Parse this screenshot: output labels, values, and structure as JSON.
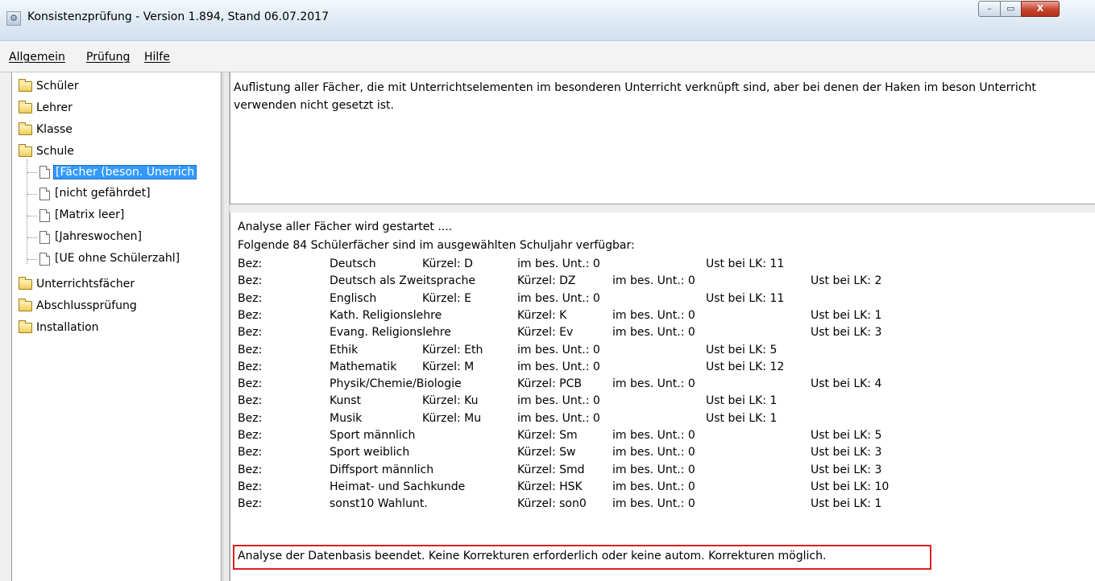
{
  "window": {
    "title": "Konsistenzprüfung - Version 1.894, Stand 06.07.2017",
    "min_glyph": "–",
    "max_glyph": "▭",
    "close_glyph": "X"
  },
  "menu": [
    "Allgemein",
    "Prüfung",
    "Hilfe"
  ],
  "tree": {
    "folders_top": [
      "Schüler",
      "Lehrer",
      "Klasse",
      "Schule"
    ],
    "schule_children": [
      "[Fächer (beson. Unerrich",
      "[nicht gefährdet]",
      "[Matrix leer]",
      "[Jahreswochen]",
      "[UE ohne Schülerzahl]"
    ],
    "folders_bottom": [
      "Unterrichtsfächer",
      "Abschlussprüfung",
      "Installation"
    ],
    "selected": "[Fächer (beson. Unerrich"
  },
  "description": "Auflistung aller Fächer, die mit Unterrichtselementen im besonderen Unterricht verknüpft sind, aber bei denen der Haken im beson Unterricht verwenden nicht gesetzt ist.",
  "log": {
    "line1": "Analyse aller Fächer wird gestartet ....",
    "line2": "Folgende 84 Schülerfächer sind im ausgewählten Schuljahr verfügbar:",
    "rows": [
      {
        "bez": "Bez:",
        "name": "Deutsch",
        "kuerzel": "Kürzel: D",
        "unt": "im bes. Unt.: 0",
        "lk": "Ust bei LK: 11"
      },
      {
        "bez": "Bez:",
        "name": "Deutsch als Zweitsprache",
        "kuerzel": "Kürzel: DZ",
        "unt": "im bes. Unt.: 0",
        "lk": "Ust bei LK: 2"
      },
      {
        "bez": "Bez:",
        "name": "Englisch",
        "kuerzel": "Kürzel: E",
        "unt": "im bes. Unt.: 0",
        "lk": "Ust bei LK: 11"
      },
      {
        "bez": "Bez:",
        "name": "Kath. Religionslehre",
        "kuerzel": "Kürzel: K",
        "unt": "im bes. Unt.: 0",
        "lk": "Ust bei LK: 1"
      },
      {
        "bez": "Bez:",
        "name": "Evang. Religionslehre",
        "kuerzel": "Kürzel: Ev",
        "unt": "im bes. Unt.: 0",
        "lk": "Ust bei LK: 3"
      },
      {
        "bez": "Bez:",
        "name": "Ethik",
        "kuerzel": "Kürzel: Eth",
        "unt": "im bes. Unt.: 0",
        "lk": "Ust bei LK: 5"
      },
      {
        "bez": "Bez:",
        "name": "Mathematik",
        "kuerzel": "Kürzel: M",
        "unt": "im bes. Unt.: 0",
        "lk": "Ust bei LK: 12"
      },
      {
        "bez": "Bez:",
        "name": "Physik/Chemie/Biologie",
        "kuerzel": "Kürzel: PCB",
        "unt": "im bes. Unt.: 0",
        "lk": "Ust bei LK: 4"
      },
      {
        "bez": "Bez:",
        "name": "Kunst",
        "kuerzel": "Kürzel: Ku",
        "unt": "im bes. Unt.: 0",
        "lk": "Ust bei LK: 1"
      },
      {
        "bez": "Bez:",
        "name": "Musik",
        "kuerzel": "Kürzel: Mu",
        "unt": "im bes. Unt.: 0",
        "lk": "Ust bei LK: 1"
      },
      {
        "bez": "Bez:",
        "name": "Sport männlich",
        "kuerzel": "Kürzel: Sm",
        "unt": "im bes. Unt.: 0",
        "lk": "Ust bei LK: 5"
      },
      {
        "bez": "Bez:",
        "name": "Sport weiblich",
        "kuerzel": "Kürzel: Sw",
        "unt": "im bes. Unt.: 0",
        "lk": "Ust bei LK: 3"
      },
      {
        "bez": "Bez:",
        "name": "Diffsport männlich",
        "kuerzel": "Kürzel: Smd",
        "unt": "im bes. Unt.: 0",
        "lk": "Ust bei LK: 3"
      },
      {
        "bez": "Bez:",
        "name": "Heimat- und Sachkunde",
        "kuerzel": "Kürzel: HSK",
        "unt": "im bes. Unt.: 0",
        "lk": "Ust bei LK: 10"
      },
      {
        "bez": "Bez:",
        "name": "sonst10 Wahlunt.",
        "kuerzel": "Kürzel: son0",
        "unt": "im bes. Unt.: 0",
        "lk": "Ust bei LK: 1"
      }
    ],
    "final_message": "Analyse der Datenbasis beendet. Keine Korrekturen erforderlich oder keine autom. Korrekturen möglich.",
    "highlight_color": "#e02020"
  },
  "colors": {
    "selection_bg": "#3399ff",
    "close_button": "#c7452e"
  }
}
